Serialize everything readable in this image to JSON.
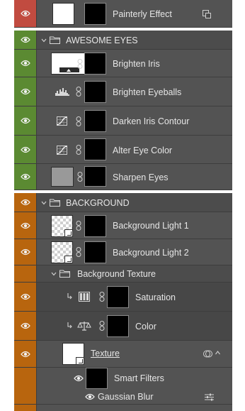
{
  "colors": {
    "red_group": "#c0392b",
    "green_group": "#5b8a32",
    "orange_group": "#b8650e"
  },
  "layers": {
    "painterly": {
      "name": "Painterly Effect",
      "badge_icon": "smart-object-icon"
    },
    "awesome_eyes": {
      "group_name": "AWESOME EYES",
      "items": [
        {
          "name": "Brighten Iris",
          "icon": "levels-thumbnail"
        },
        {
          "name": "Brighten Eyeballs",
          "icon": "levels-histogram-icon"
        },
        {
          "name": "Darken Iris Contour",
          "icon": "curves-icon"
        },
        {
          "name": "Alter Eye Color",
          "icon": "curves-icon"
        },
        {
          "name": "Sharpen Eyes",
          "icon": "gray-thumbnail"
        }
      ]
    },
    "background": {
      "group_name": "BACKGROUND",
      "items": [
        {
          "name": "Background Light 1"
        },
        {
          "name": "Background Light 2"
        }
      ],
      "subgroup": {
        "name": "Background Texture",
        "items": [
          {
            "name": "Saturation",
            "icon": "hue-saturation-icon"
          },
          {
            "name": "Color",
            "icon": "color-balance-icon"
          }
        ]
      },
      "texture": {
        "name": "Texture",
        "smart_filters": "Smart Filters",
        "filter": "Gaussian Blur"
      }
    }
  }
}
